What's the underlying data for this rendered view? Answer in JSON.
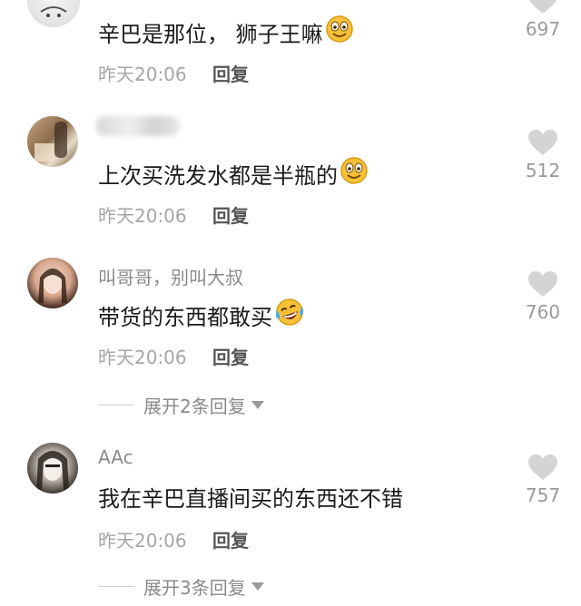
{
  "comments": [
    {
      "username": "",
      "text": "辛巴是那位， 狮子王嘛",
      "emoji": "grin-emoji",
      "time": "昨天20:06",
      "reply_label": "回复",
      "likes": "697"
    },
    {
      "username": "",
      "text": "上次买洗发水都是半瓶的",
      "emoji": "grin-emoji",
      "time": "昨天20:06",
      "reply_label": "回复",
      "likes": "512"
    },
    {
      "username": "叫哥哥，别叫大叔",
      "text": "带货的东西都敢买",
      "emoji": "laugh-cry-emoji",
      "time": "昨天20:06",
      "reply_label": "回复",
      "likes": "760",
      "expand_label": "展开2条回复"
    },
    {
      "username": "AAc",
      "text": "我在辛巴直播间买的东西还不错",
      "time": "昨天20:06",
      "reply_label": "回复",
      "likes": "757",
      "expand_label": "展开3条回复"
    }
  ],
  "colors": {
    "username": "#8a8a8a",
    "text": "#1a1a1a",
    "timestamp": "#a6a6a6",
    "reply": "#555555",
    "like_icon": "#d4d4d4",
    "count": "#9a9a9a"
  }
}
